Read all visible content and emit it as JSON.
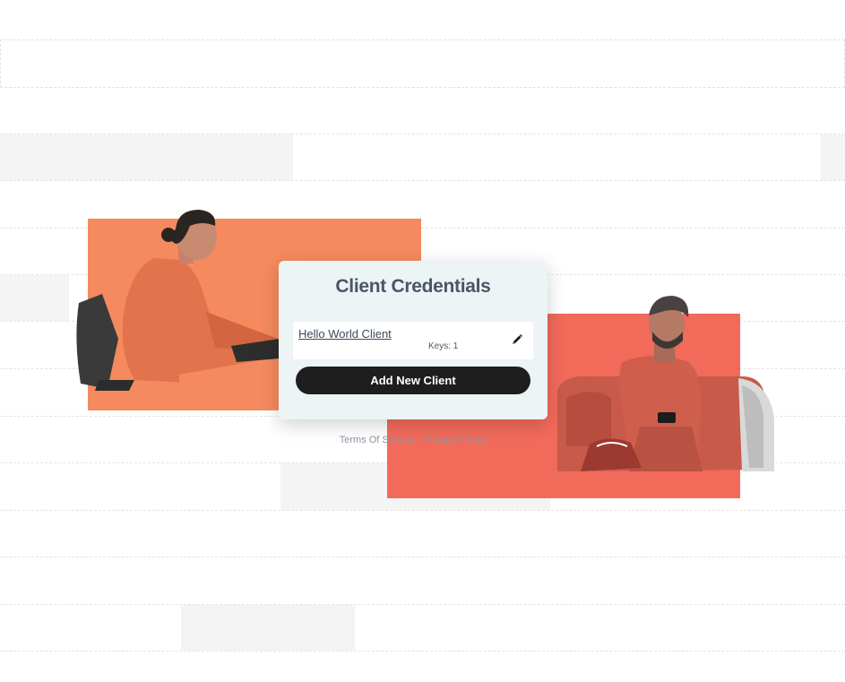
{
  "card": {
    "title": "Client Credentials",
    "clients": [
      {
        "name": "Hello World Client",
        "keys_label": "Keys: 1"
      }
    ],
    "add_button": "Add New Client"
  },
  "footer": {
    "terms": "Terms Of Service",
    "separator": "-",
    "privacy": "Privacy Policy"
  },
  "icons": {
    "edit": "pencil-icon"
  },
  "colors": {
    "card_bg": "#edf4f6",
    "button_bg": "#1e1e1e",
    "photo_left_bg": "#f48a5e",
    "photo_right_bg": "#f26a5a",
    "title_text": "#4a5568"
  }
}
